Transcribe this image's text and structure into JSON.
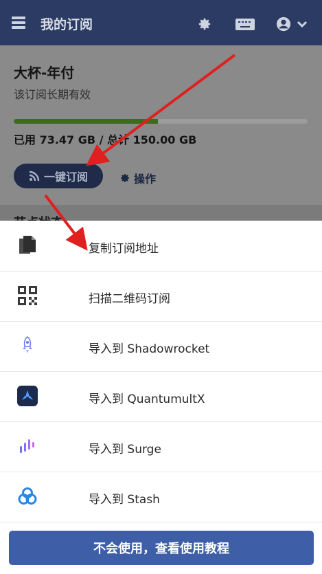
{
  "header": {
    "title": "我的订阅",
    "icons": [
      "menu-icon",
      "gear-icon",
      "keyboard-icon",
      "user-circle-icon",
      "chevron-down-icon"
    ]
  },
  "subscription": {
    "plan_name": "大杯-年付",
    "validity": "该订阅长期有效",
    "usage_text": "已用 73.47 GB / 总计 150.00 GB",
    "used_fraction": 0.49,
    "subscribe_button": "一键订阅",
    "operate_button": "操作"
  },
  "section_peek": "节点状态",
  "sheet": {
    "items": [
      {
        "label": "复制订阅地址",
        "icon": "copy-icon"
      },
      {
        "label": "扫描二维码订阅",
        "icon": "qr-code-icon"
      },
      {
        "label": "导入到 Shadowrocket",
        "icon": "shadowrocket-icon"
      },
      {
        "label": "导入到 QuantumultX",
        "icon": "quantumultx-icon"
      },
      {
        "label": "导入到 Surge",
        "icon": "surge-icon"
      },
      {
        "label": "导入到 Stash",
        "icon": "stash-icon"
      }
    ],
    "help_button": "不会使用，查看使用教程"
  },
  "colors": {
    "header_bg": "#2b3b63",
    "progress_fill": "#3c6b1e",
    "help_button_bg": "#3e5fa8",
    "annotation_arrow": "#e02020"
  }
}
